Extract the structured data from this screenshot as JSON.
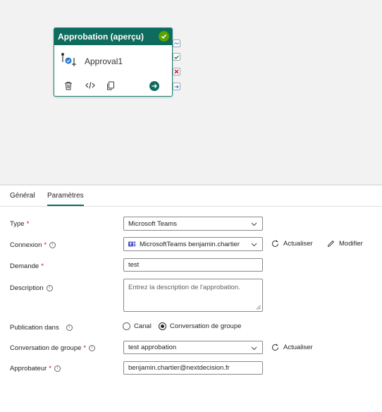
{
  "card": {
    "title": "Approbation (aperçu)",
    "name": "Approval1",
    "header_color": "#0e6b5e",
    "status_color": "#57a300"
  },
  "ports": [
    "skip",
    "success",
    "fail",
    "complete"
  ],
  "tabs": [
    {
      "label": "Général",
      "active": false
    },
    {
      "label": "Paramètres",
      "active": true
    }
  ],
  "form": {
    "type": {
      "label": "Type",
      "required": "*",
      "value": "Microsoft Teams"
    },
    "connexion": {
      "label": "Connexion",
      "required": "*",
      "value": "MicrosoftTeams benjamin.chartier",
      "refresh_label": "Actualiser",
      "edit_label": "Modifier"
    },
    "demande": {
      "label": "Demande",
      "required": "*",
      "value": "test"
    },
    "description": {
      "label": "Description",
      "placeholder": "Entrez la description de l'approbation."
    },
    "publication": {
      "label": "Publication dans",
      "options": [
        "Canal",
        "Conversation de groupe"
      ],
      "selected": "Conversation de groupe"
    },
    "conversation": {
      "label": "Conversation de groupe",
      "required": "*",
      "value": "test approbation",
      "refresh_label": "Actualiser"
    },
    "approbateur": {
      "label": "Approbateur",
      "required": "*",
      "value": "benjamin.chartier@nextdecision.fr"
    }
  },
  "icons": {
    "header_status": "check-circle-icon",
    "activity": "approval-activity-icon",
    "delete": "trash-icon",
    "code": "code-icon",
    "copy": "copy-icon",
    "run": "arrow-right-circle-icon",
    "refresh": "refresh-icon",
    "edit": "pencil-icon",
    "teams": "teams-icon",
    "chevron": "chevron-down-icon",
    "info": "info-icon"
  },
  "colors": {
    "accent": "#0e6b5e",
    "required": "#c50f1f"
  }
}
